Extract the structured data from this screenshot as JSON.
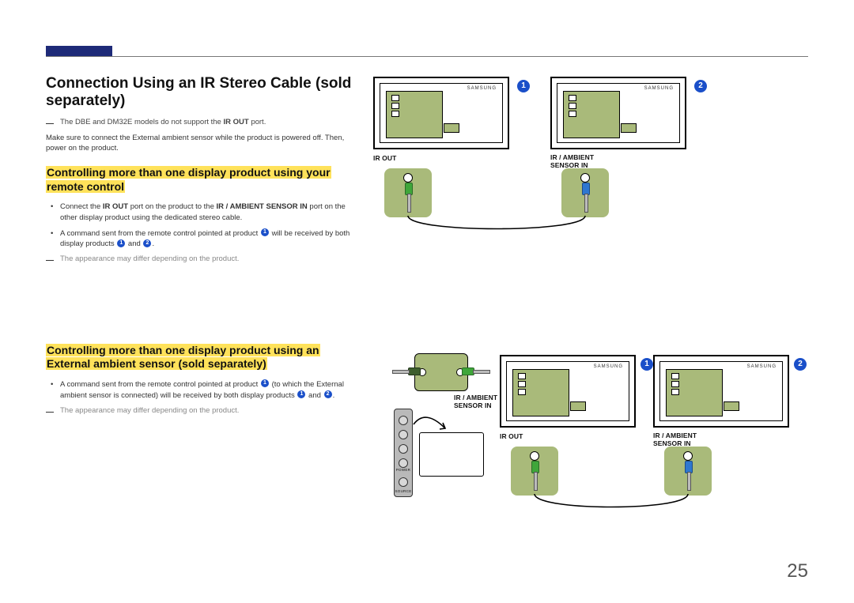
{
  "page_number": "25",
  "title": "Connection Using an IR Stereo Cable (sold separately)",
  "note1_pre": "The DBE and DM32E models do not support the ",
  "note1_bold": "IR OUT",
  "note1_post": " port.",
  "body1": "Make sure to connect the External ambient sensor while the product is powered off. Then, power on the product.",
  "sub1": "Controlling more than one display product using your remote control",
  "s1_b1_pre": "Connect the ",
  "s1_b1_bold1": "IR OUT",
  "s1_b1_mid": " port on the product to the ",
  "s1_b1_bold2": "IR / AMBIENT SENSOR IN",
  "s1_b1_post": " port on the other display product using the dedicated stereo cable.",
  "s1_b2_a": "A command sent from the remote control pointed at product ",
  "s1_b2_b": " will be received by both display products ",
  "s1_b2_c": " and ",
  "s1_b2_d": ".",
  "appearance_note": "The appearance may differ depending on the product.",
  "sub2": "Controlling more than one display product using an External ambient sensor (sold separately)",
  "s2_b1_a": "A command sent from the remote control pointed at product ",
  "s2_b1_b": " (to which the External ambient sensor is connected) will be received by both display products ",
  "s2_b1_c": " and ",
  "s2_b1_d": ".",
  "num1": "1",
  "num2": "2",
  "labels": {
    "irout": "IR OUT",
    "irambient": "IR / AMBIENT SENSOR IN",
    "samsung": "SAMSUNG",
    "power": "POWER",
    "source": "SOURCE"
  }
}
